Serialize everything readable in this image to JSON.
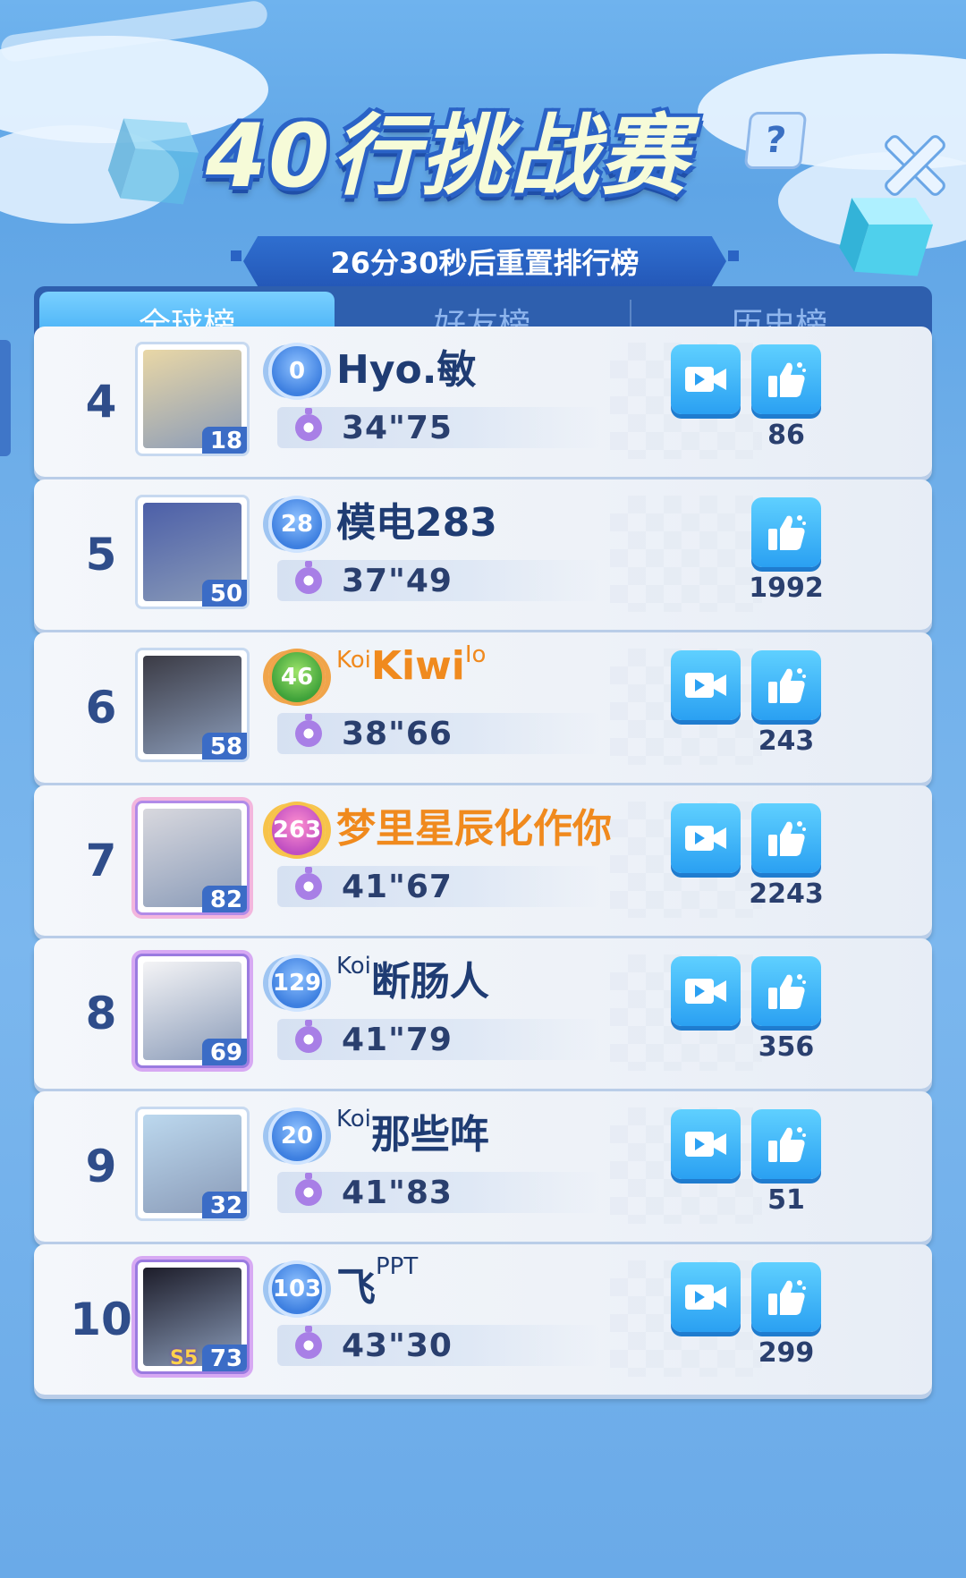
{
  "header": {
    "title": "40行挑战赛",
    "help_label": "?",
    "reset_text": "26分30秒后重置排行榜"
  },
  "tabs": [
    {
      "label": "全球榜",
      "active": true
    },
    {
      "label": "好友榜",
      "active": false
    },
    {
      "label": "历史榜",
      "active": false
    }
  ],
  "rows": [
    {
      "rank": "4",
      "avatar_level": "18",
      "badge": "0",
      "name_pre": "",
      "name": "Hyo.敏",
      "name_post": "",
      "time": "34\"75",
      "has_video": true,
      "likes": "86",
      "name_color": "#1f3c73",
      "badge_style": "blue",
      "avatar_color": "#e9d7a6"
    },
    {
      "rank": "5",
      "avatar_level": "50",
      "badge": "28",
      "name_pre": "",
      "name": "模电283",
      "name_post": "",
      "time": "37\"49",
      "has_video": false,
      "likes": "1992",
      "name_color": "#1f3c73",
      "badge_style": "blue",
      "avatar_color": "#4c5fa8"
    },
    {
      "rank": "6",
      "avatar_level": "58",
      "badge": "46",
      "name_pre": "Koi",
      "name": "Kiwi",
      "name_post": "Io",
      "time": "38\"66",
      "has_video": true,
      "likes": "243",
      "name_color": "#f08a1e",
      "badge_style": "green",
      "avatar_color": "#3b3b45"
    },
    {
      "rank": "7",
      "avatar_level": "82",
      "badge": "263",
      "name_pre": "",
      "name": "梦里星辰化作你",
      "name_post": "",
      "time": "41\"67",
      "has_video": true,
      "likes": "2243",
      "name_color": "#f08a1e",
      "badge_style": "pink",
      "avatar_color": "#d8d8de"
    },
    {
      "rank": "8",
      "avatar_level": "69",
      "badge": "129",
      "name_pre": "Koi",
      "name": "断肠人",
      "name_post": "",
      "time": "41\"79",
      "has_video": true,
      "likes": "356",
      "name_color": "#1f3c73",
      "badge_style": "blue",
      "avatar_color": "#f4f4f6"
    },
    {
      "rank": "9",
      "avatar_level": "32",
      "badge": "20",
      "name_pre": "Koi",
      "name": "那些哖",
      "name_post": "",
      "time": "41\"83",
      "has_video": true,
      "likes": "51",
      "name_color": "#1f3c73",
      "badge_style": "blue",
      "avatar_color": "#bcd8ee"
    },
    {
      "rank": "10",
      "avatar_level": "73",
      "badge": "103",
      "name_pre": "",
      "name": "飞",
      "name_post": "PPT",
      "time": "43\"30",
      "has_video": true,
      "likes": "299",
      "name_color": "#1f3c73",
      "badge_style": "blue",
      "avatar_color": "#1d1d2a",
      "avatar_tag": "S5"
    }
  ],
  "icons": {
    "video": "video-camera-icon",
    "like": "thumbs-up-icon",
    "timer": "stopwatch-icon",
    "close": "close-icon",
    "help": "question-icon"
  },
  "colors": {
    "accent": "#35a6f3",
    "tab_bar": "#2e5fae",
    "title_fill": "#f6fbd8",
    "vip_name": "#f08a1e"
  }
}
